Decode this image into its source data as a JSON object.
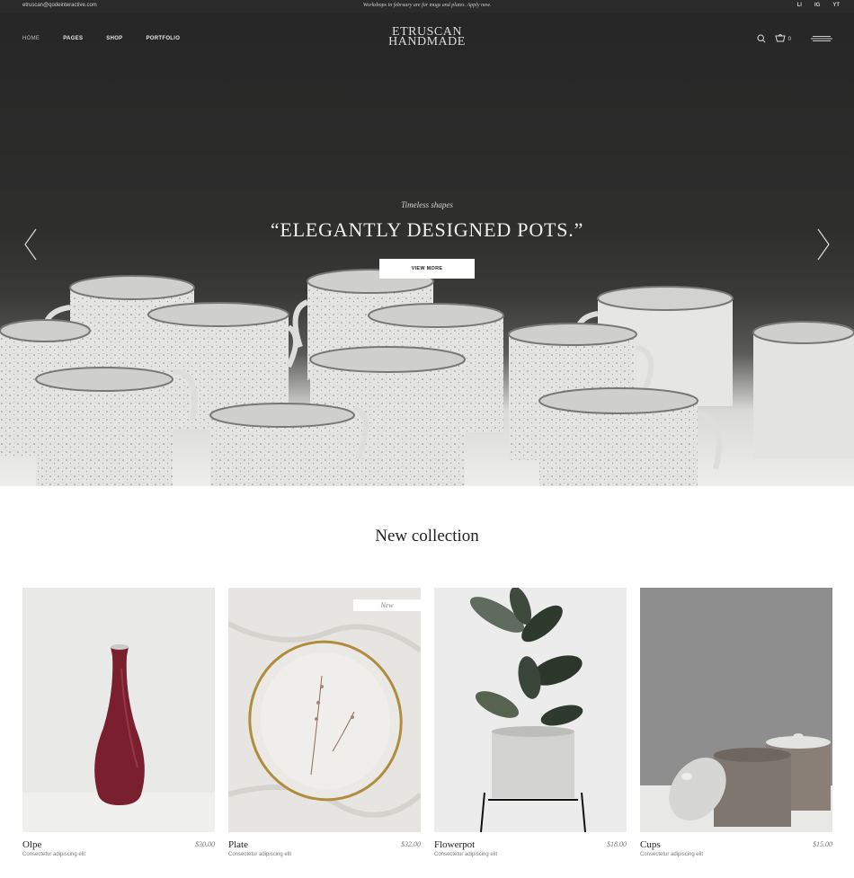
{
  "topbar": {
    "email": "etruscan@qodeinteractive.com",
    "promo": "Workshops in february are for mugs and plates. Apply now.",
    "social": [
      "LI",
      "IG",
      "YT"
    ]
  },
  "header": {
    "nav": [
      "HOME",
      "PAGES",
      "SHOP",
      "PORTFOLIO"
    ],
    "logo_line1": "ETRUSCAN",
    "logo_line2": "HANDMADE",
    "cart_count": "0"
  },
  "hero": {
    "subtitle": "Timeless shapes",
    "title": "“ELEGANTLY DESIGNED POTS.”",
    "button_label": "VIEW MORE"
  },
  "collection": {
    "title": "New collection",
    "products": [
      {
        "name": "Olpe",
        "price": "$30.00",
        "desc": "Consectetur adipiscing elit",
        "badge": ""
      },
      {
        "name": "Plate",
        "price": "$32.00",
        "desc": "Consectetur adipiscing elit",
        "badge": "New"
      },
      {
        "name": "Flowerpot",
        "price": "$18.00",
        "desc": "Consectetur adipiscing elit",
        "badge": ""
      },
      {
        "name": "Cups",
        "price": "$15.00",
        "desc": "Consectetur adipiscing elit",
        "badge": ""
      }
    ]
  },
  "icons": {
    "search": "search-icon",
    "cart": "cart-icon",
    "menu": "menu-icon",
    "prev": "chevron-left-icon",
    "next": "chevron-right-icon"
  },
  "colors": {
    "topbar": "#2a2a2a",
    "hero_bg": "#2e2e2d",
    "button_bg": "#ffffff"
  }
}
